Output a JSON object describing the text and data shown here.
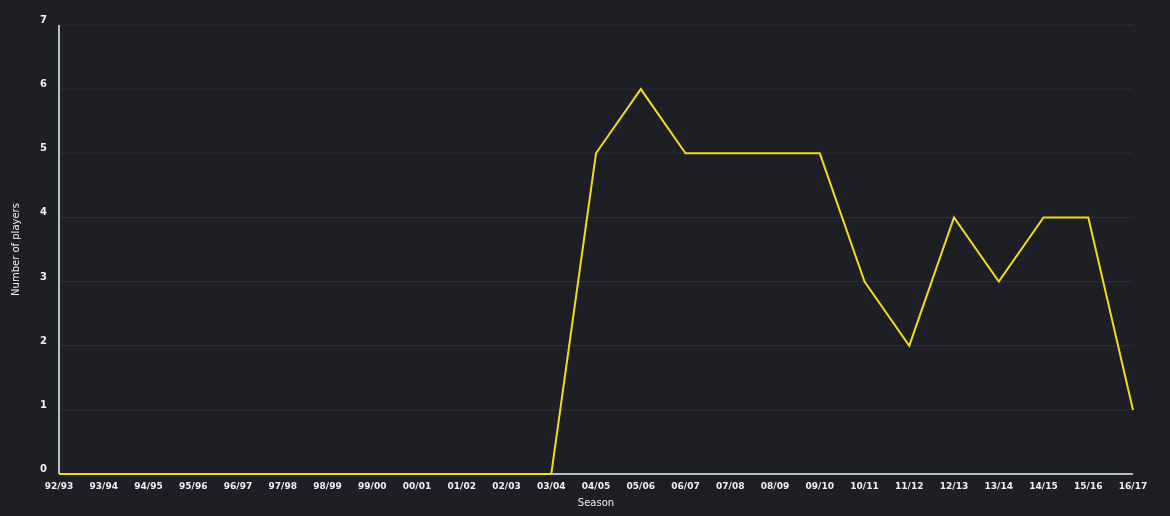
{
  "chart_data": {
    "type": "line",
    "xlabel": "Season",
    "ylabel": "Number of players",
    "categories": [
      "92/93",
      "93/94",
      "94/95",
      "95/96",
      "96/97",
      "97/98",
      "98/99",
      "99/00",
      "00/01",
      "01/02",
      "02/03",
      "03/04",
      "04/05",
      "05/06",
      "06/07",
      "07/08",
      "08/09",
      "09/10",
      "10/11",
      "11/12",
      "12/13",
      "13/14",
      "14/15",
      "15/16",
      "16/17"
    ],
    "series": [
      {
        "color": "#f2da1f",
        "values": [
          0,
          0,
          0,
          0,
          0,
          0,
          0,
          0,
          0,
          0,
          0,
          0,
          5,
          6,
          5,
          5,
          5,
          5,
          3,
          2,
          4,
          3,
          4,
          4,
          1
        ]
      }
    ],
    "grid": true,
    "ylim": [
      0,
      7
    ],
    "yticks": [
      0,
      1,
      2,
      3,
      4,
      5,
      6,
      7
    ]
  }
}
